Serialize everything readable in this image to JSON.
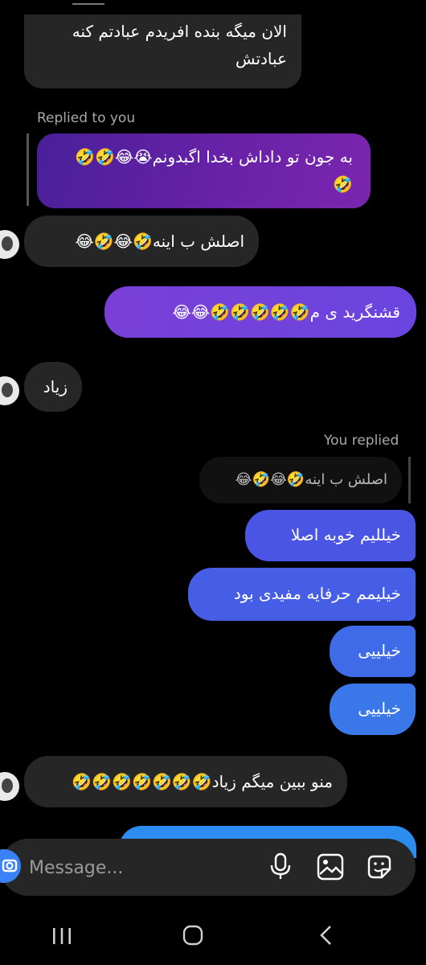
{
  "messages": {
    "m1": "الان میگه بنده افریدم عبادتم کنه\nعبادتش",
    "reply_label_1": "Replied to you",
    "m2_quote": "به جون تو داداش بخدا اگبدونم😭😂🤣🤣\n🤣",
    "m3": "اصلش ب اینه🤣😂🤣😂",
    "m4": "قشنگرید ی م🤣🤣🤣🤣🤣😂😂",
    "m5": "زیاد",
    "reply_label_2": "You replied",
    "m6_quote": "اصلش ب اینه🤣😂🤣😂",
    "m7": "خیللیم خوبه اصلا",
    "m8": "خیلیمم حرفایه مفیدی بود",
    "m9": "خیلییی",
    "m10": "خیلییی",
    "m11": "منو ببین میگم زیاد🤣🤣🤣🤣🤣🤣🤣"
  },
  "composer": {
    "placeholder": "Message...",
    "icons": [
      "camera-icon",
      "microphone-icon",
      "gallery-icon",
      "sticker-icon"
    ]
  },
  "navbar": {
    "icons": [
      "recent-apps-icon",
      "home-icon",
      "back-icon"
    ]
  },
  "colors": {
    "background": "#000000",
    "received_bubble": "#262626",
    "sent_bubble_purple": "#7a3fd6",
    "sent_bubble_blue": "#3e63e6",
    "composer_bg": "#262626"
  }
}
